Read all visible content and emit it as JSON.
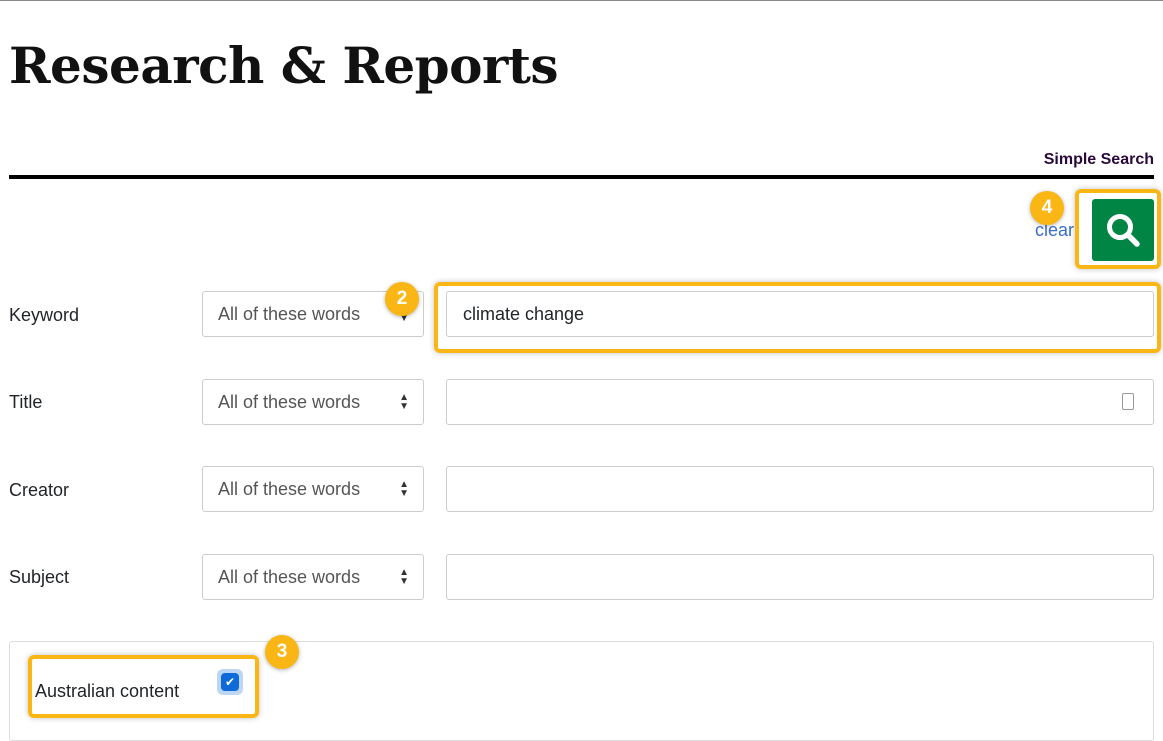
{
  "page": {
    "title": "Research & Reports",
    "mode_link": "Simple Search"
  },
  "actions": {
    "clear_label": "clear",
    "search_icon": "search-icon",
    "search_color": "#008545"
  },
  "rows": [
    {
      "label": "Keyword",
      "match": "All of these words",
      "value": "climate change"
    },
    {
      "label": "Title",
      "match": "All of these words",
      "value": ""
    },
    {
      "label": "Creator",
      "match": "All of these words",
      "value": ""
    },
    {
      "label": "Subject",
      "match": "All of these words",
      "value": ""
    }
  ],
  "filters": {
    "australian_content": {
      "label": "Australian content",
      "checked": true
    }
  },
  "annotations": {
    "badge_2": "2",
    "badge_3": "3",
    "badge_4": "4",
    "highlight_color": "#f9b614"
  }
}
